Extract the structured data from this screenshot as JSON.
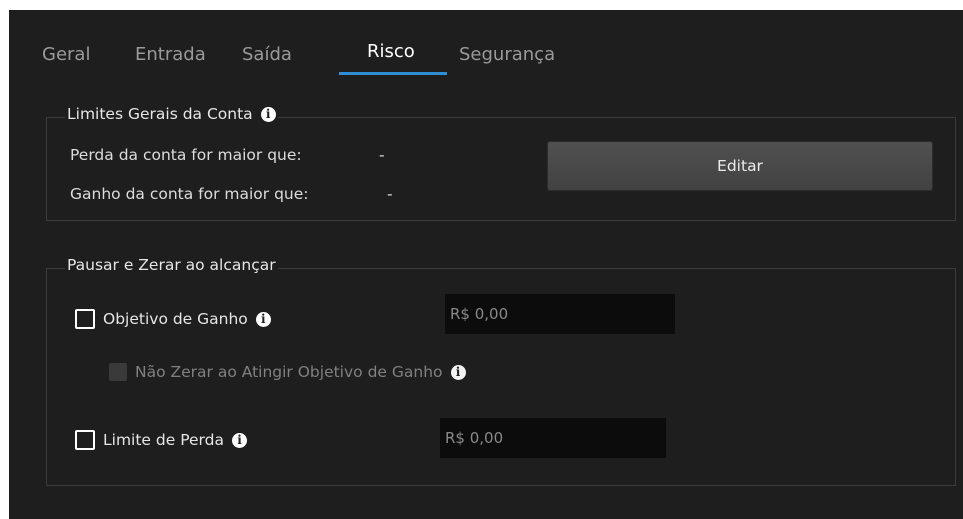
{
  "tabs": [
    {
      "label": "Geral",
      "active": false
    },
    {
      "label": "Entrada",
      "active": false
    },
    {
      "label": "Saída",
      "active": false
    },
    {
      "label": "Risco",
      "active": true
    },
    {
      "label": "Segurança",
      "active": false
    }
  ],
  "account_limits": {
    "title": "Limites Gerais da Conta",
    "loss_label": "Perda da conta for maior que:",
    "loss_value": "-",
    "gain_label": "Ganho da conta for maior que:",
    "gain_value": "-",
    "edit_button": "Editar"
  },
  "pause_reset": {
    "title": "Pausar e Zerar ao alcançar",
    "gain_goal_label": "Objetivo de Ganho",
    "gain_goal_checked": false,
    "gain_goal_value": "R$ 0,00",
    "no_reset_label": "Não Zerar ao Atingir Objetivo de Ganho",
    "no_reset_enabled": false,
    "loss_limit_label": "Limite de Perda",
    "loss_limit_checked": false,
    "loss_limit_value": "R$ 0,00"
  },
  "icons": {
    "info": "info-icon"
  },
  "colors": {
    "background": "#1e1e1e",
    "active_tab_underline": "#2f8fd6",
    "input_background": "#0c0c0c"
  }
}
